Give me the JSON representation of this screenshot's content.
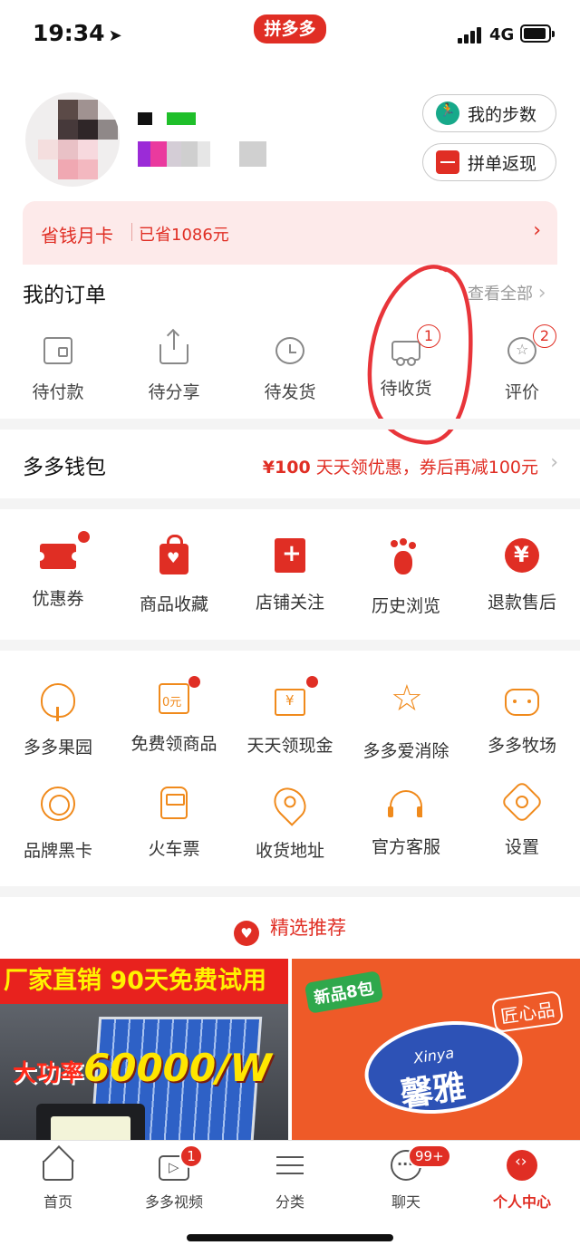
{
  "status_bar": {
    "time": "19:34",
    "location_glyph": "➤",
    "app_badge": "拼多多",
    "network": "4G"
  },
  "profile": {
    "steps_button": "我的步数",
    "cashback_button": "拼单返现",
    "steps_icon": "runner-icon",
    "cashback_icon": "red-envelope-icon"
  },
  "savings_card": {
    "title": "省钱月卡",
    "amount": "已省1086元",
    "arrow": "›"
  },
  "orders": {
    "title": "我的订单",
    "view_all": "查看全部",
    "chevron": "›",
    "items": [
      {
        "label": "待付款",
        "icon": "wallet-icon",
        "badge": ""
      },
      {
        "label": "待分享",
        "icon": "share-icon",
        "badge": ""
      },
      {
        "label": "待发货",
        "icon": "clock-icon",
        "badge": ""
      },
      {
        "label": "待收货",
        "icon": "truck-icon",
        "badge": "1"
      },
      {
        "label": "评价",
        "icon": "star-review-icon",
        "badge": "2"
      }
    ]
  },
  "wallet": {
    "title": "多多钱包",
    "promo_amount": "¥100",
    "promo_text": " 天天领优惠，券后再减100元",
    "chevron": "›"
  },
  "quick_services": {
    "items": [
      {
        "label": "优惠券",
        "icon": "coupon-icon",
        "dot": true
      },
      {
        "label": "商品收藏",
        "icon": "favorite-bag-icon",
        "dot": false
      },
      {
        "label": "店铺关注",
        "icon": "store-follow-icon",
        "dot": false
      },
      {
        "label": "历史浏览",
        "icon": "footprint-icon",
        "dot": false
      },
      {
        "label": "退款售后",
        "icon": "refund-icon",
        "dot": false
      }
    ]
  },
  "more_services": {
    "row1": [
      {
        "label": "多多果园",
        "icon": "tree-icon",
        "dot": false
      },
      {
        "label": "免费领商品",
        "icon": "free-gift-icon",
        "dot": true
      },
      {
        "label": "天天领现金",
        "icon": "cash-envelope-icon",
        "dot": true
      },
      {
        "label": "多多爱消除",
        "icon": "star-wand-icon",
        "dot": false
      },
      {
        "label": "多多牧场",
        "icon": "cow-icon",
        "dot": false
      }
    ],
    "row2": [
      {
        "label": "品牌黑卡",
        "icon": "medal-icon"
      },
      {
        "label": "火车票",
        "icon": "train-icon"
      },
      {
        "label": "收货地址",
        "icon": "location-pin-icon"
      },
      {
        "label": "官方客服",
        "icon": "headset-icon"
      },
      {
        "label": "设置",
        "icon": "gear-icon"
      }
    ]
  },
  "recommend": {
    "title": "精选推荐",
    "icon": "heart-icon",
    "products": [
      {
        "banner": "厂家直销 90天免费试用",
        "power_label": "大功率",
        "power_value": "60000/W"
      },
      {
        "tag": "新品8包",
        "brand_latin": "Xinya",
        "brand": "馨雅",
        "stamp": "匠心品"
      }
    ]
  },
  "bottom_nav": {
    "items": [
      {
        "label": "首页",
        "icon": "home-icon",
        "badge": "",
        "active": false
      },
      {
        "label": "多多视频",
        "icon": "video-icon",
        "badge": "1",
        "active": false
      },
      {
        "label": "分类",
        "icon": "category-list-icon",
        "badge": "",
        "active": false
      },
      {
        "label": "聊天",
        "icon": "chat-icon",
        "badge": "99+",
        "active": false
      },
      {
        "label": "个人中心",
        "icon": "profile-icon",
        "badge": "",
        "active": true
      }
    ]
  },
  "colors": {
    "brand_red": "#e02e24",
    "accent_orange": "#f08a1c",
    "savings_bg": "#fdeaea",
    "annotation_red": "#e8353a"
  }
}
